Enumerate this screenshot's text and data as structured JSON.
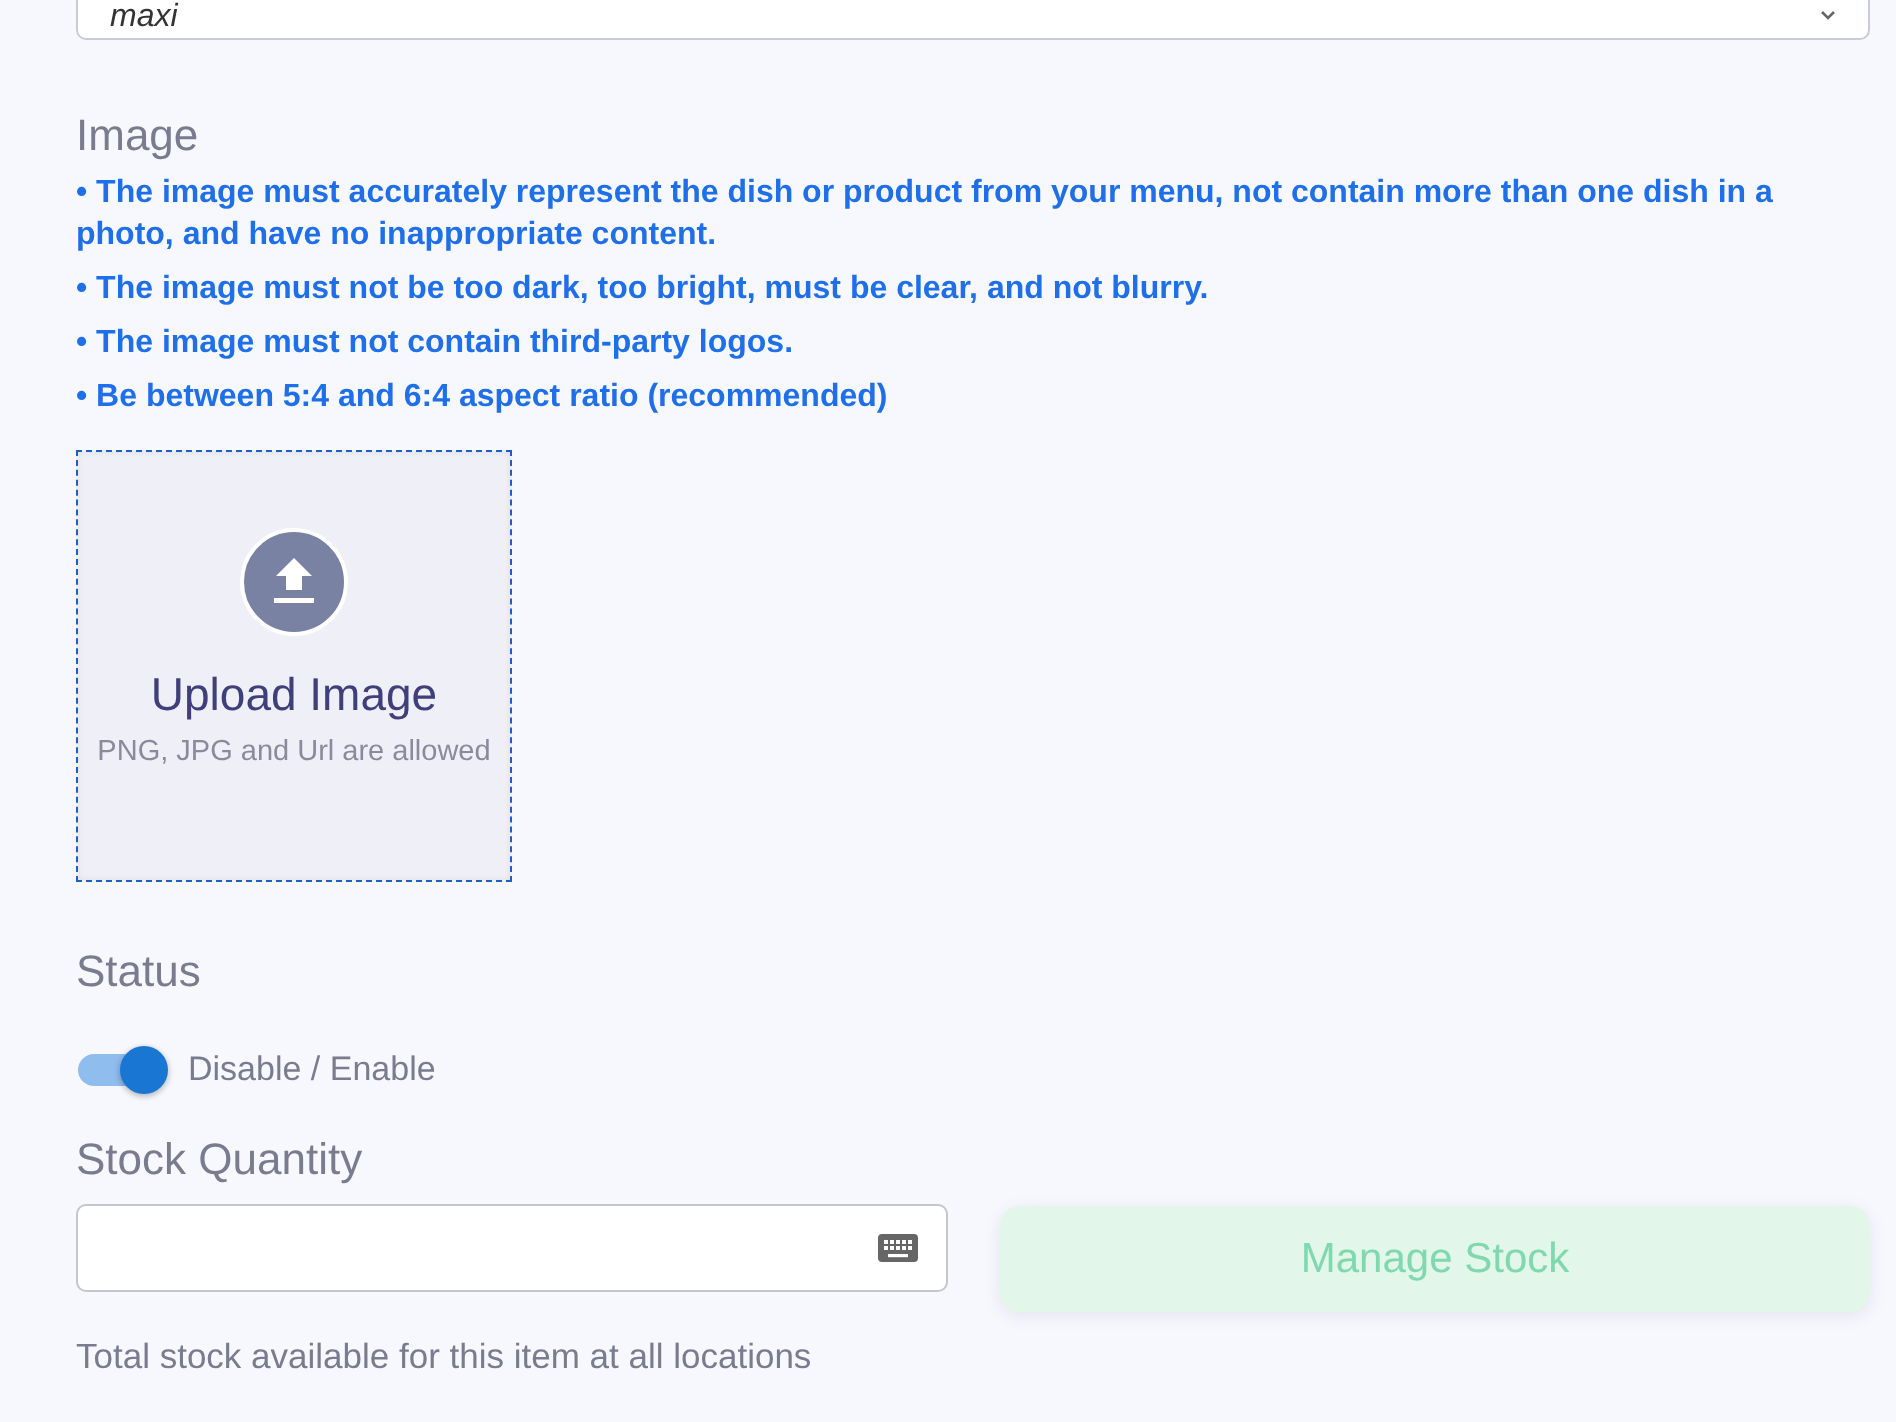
{
  "select_field": {
    "value": "maxi"
  },
  "image_section": {
    "label": "Image",
    "guidelines": [
      "• The image must accurately represent the dish or product from your menu, not contain more than one dish in a photo, and have no inappropriate content.",
      "• The image must not be too dark, too bright, must be clear, and not blurry.",
      "• The image must not contain third-party logos.",
      "• Be between 5:4 and 6:4 aspect ratio (recommended)"
    ]
  },
  "upload": {
    "title": "Upload Image",
    "hint": "PNG, JPG and Url are allowed"
  },
  "status": {
    "label": "Status",
    "toggle": {
      "label": "Disable / Enable",
      "on": true
    }
  },
  "stock_quantity": {
    "label": "Stock Quantity",
    "helper": "Total stock available for this item at all locations"
  },
  "manage_stock_button": {
    "label": "Manage Stock"
  }
}
